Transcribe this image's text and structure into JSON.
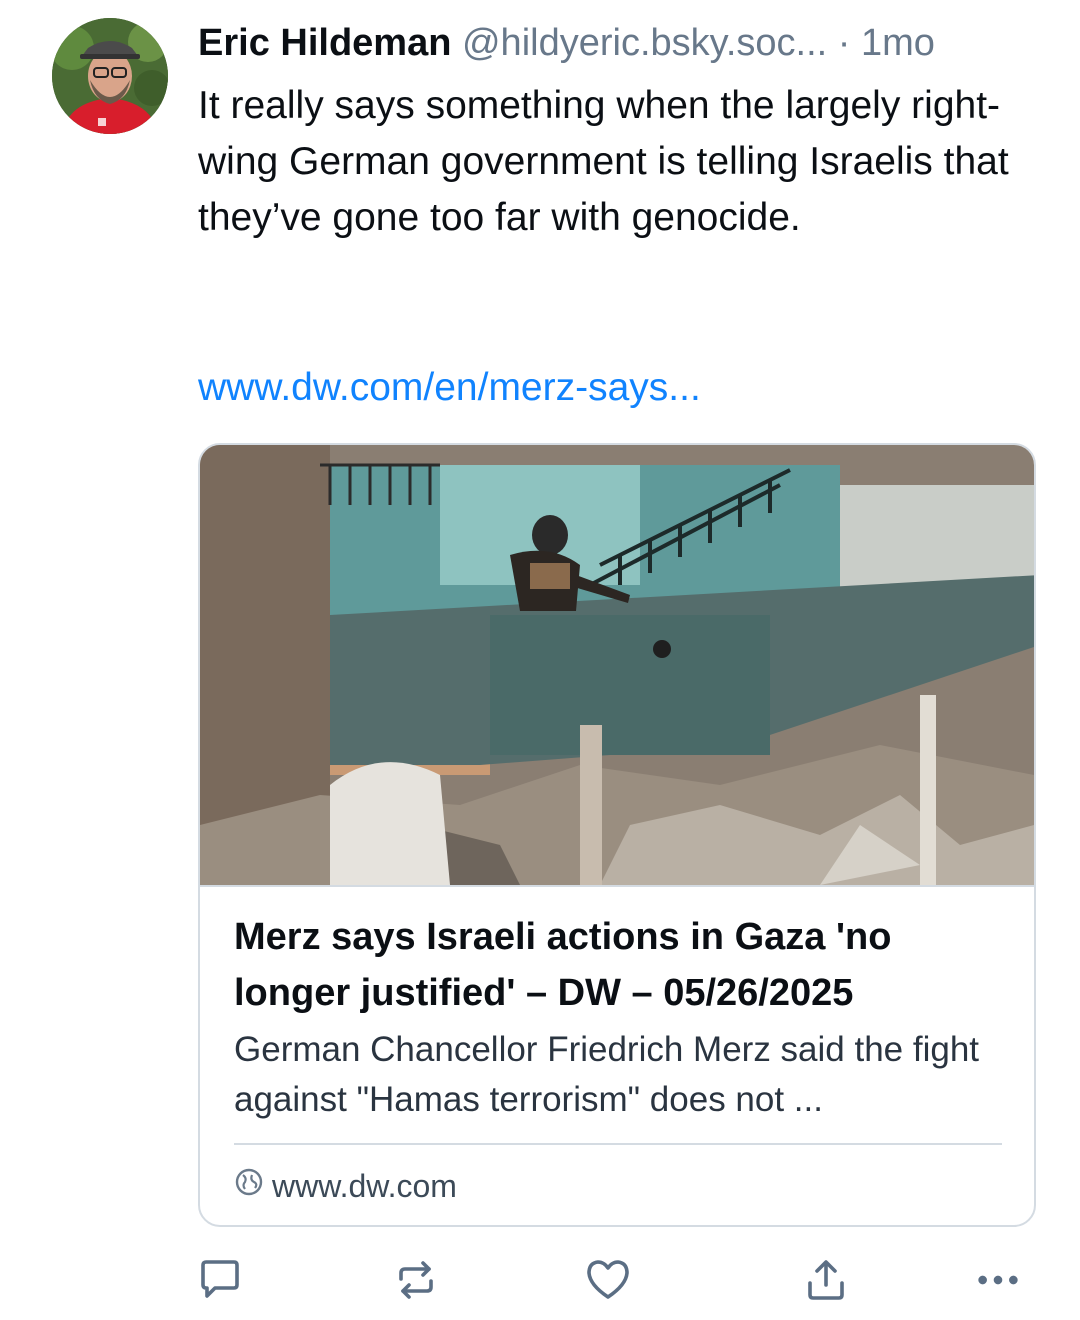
{
  "post": {
    "author": {
      "name": "Eric Hildeman",
      "handle": "@hildyeric.bsky.soc...",
      "avatar_icon": "user-avatar-photo"
    },
    "separator": "·",
    "time": "1mo",
    "text": "It really says something when the largely right-wing German government is telling Israelis that they’ve gone too far with genocide.",
    "link": "www.dw.com/en/merz-says..."
  },
  "link_card": {
    "image_icon": "article-photo",
    "title": "Merz says Israeli actions in Gaza 'no longer justified' – DW – 05/26/2025",
    "description": "German Chancellor Friedrich Merz said the fight against \"Hamas terrorism\" does not ...",
    "domain": "www.dw.com",
    "domain_icon": "globe-icon"
  },
  "actions": {
    "reply_icon": "reply-icon",
    "repost_icon": "repost-icon",
    "like_icon": "heart-icon",
    "share_icon": "share-icon",
    "more_icon": "more-icon"
  },
  "colors": {
    "link": "#1083fe",
    "muted": "#68788a",
    "border": "#d4dbe2",
    "icon": "#5b6e84"
  }
}
